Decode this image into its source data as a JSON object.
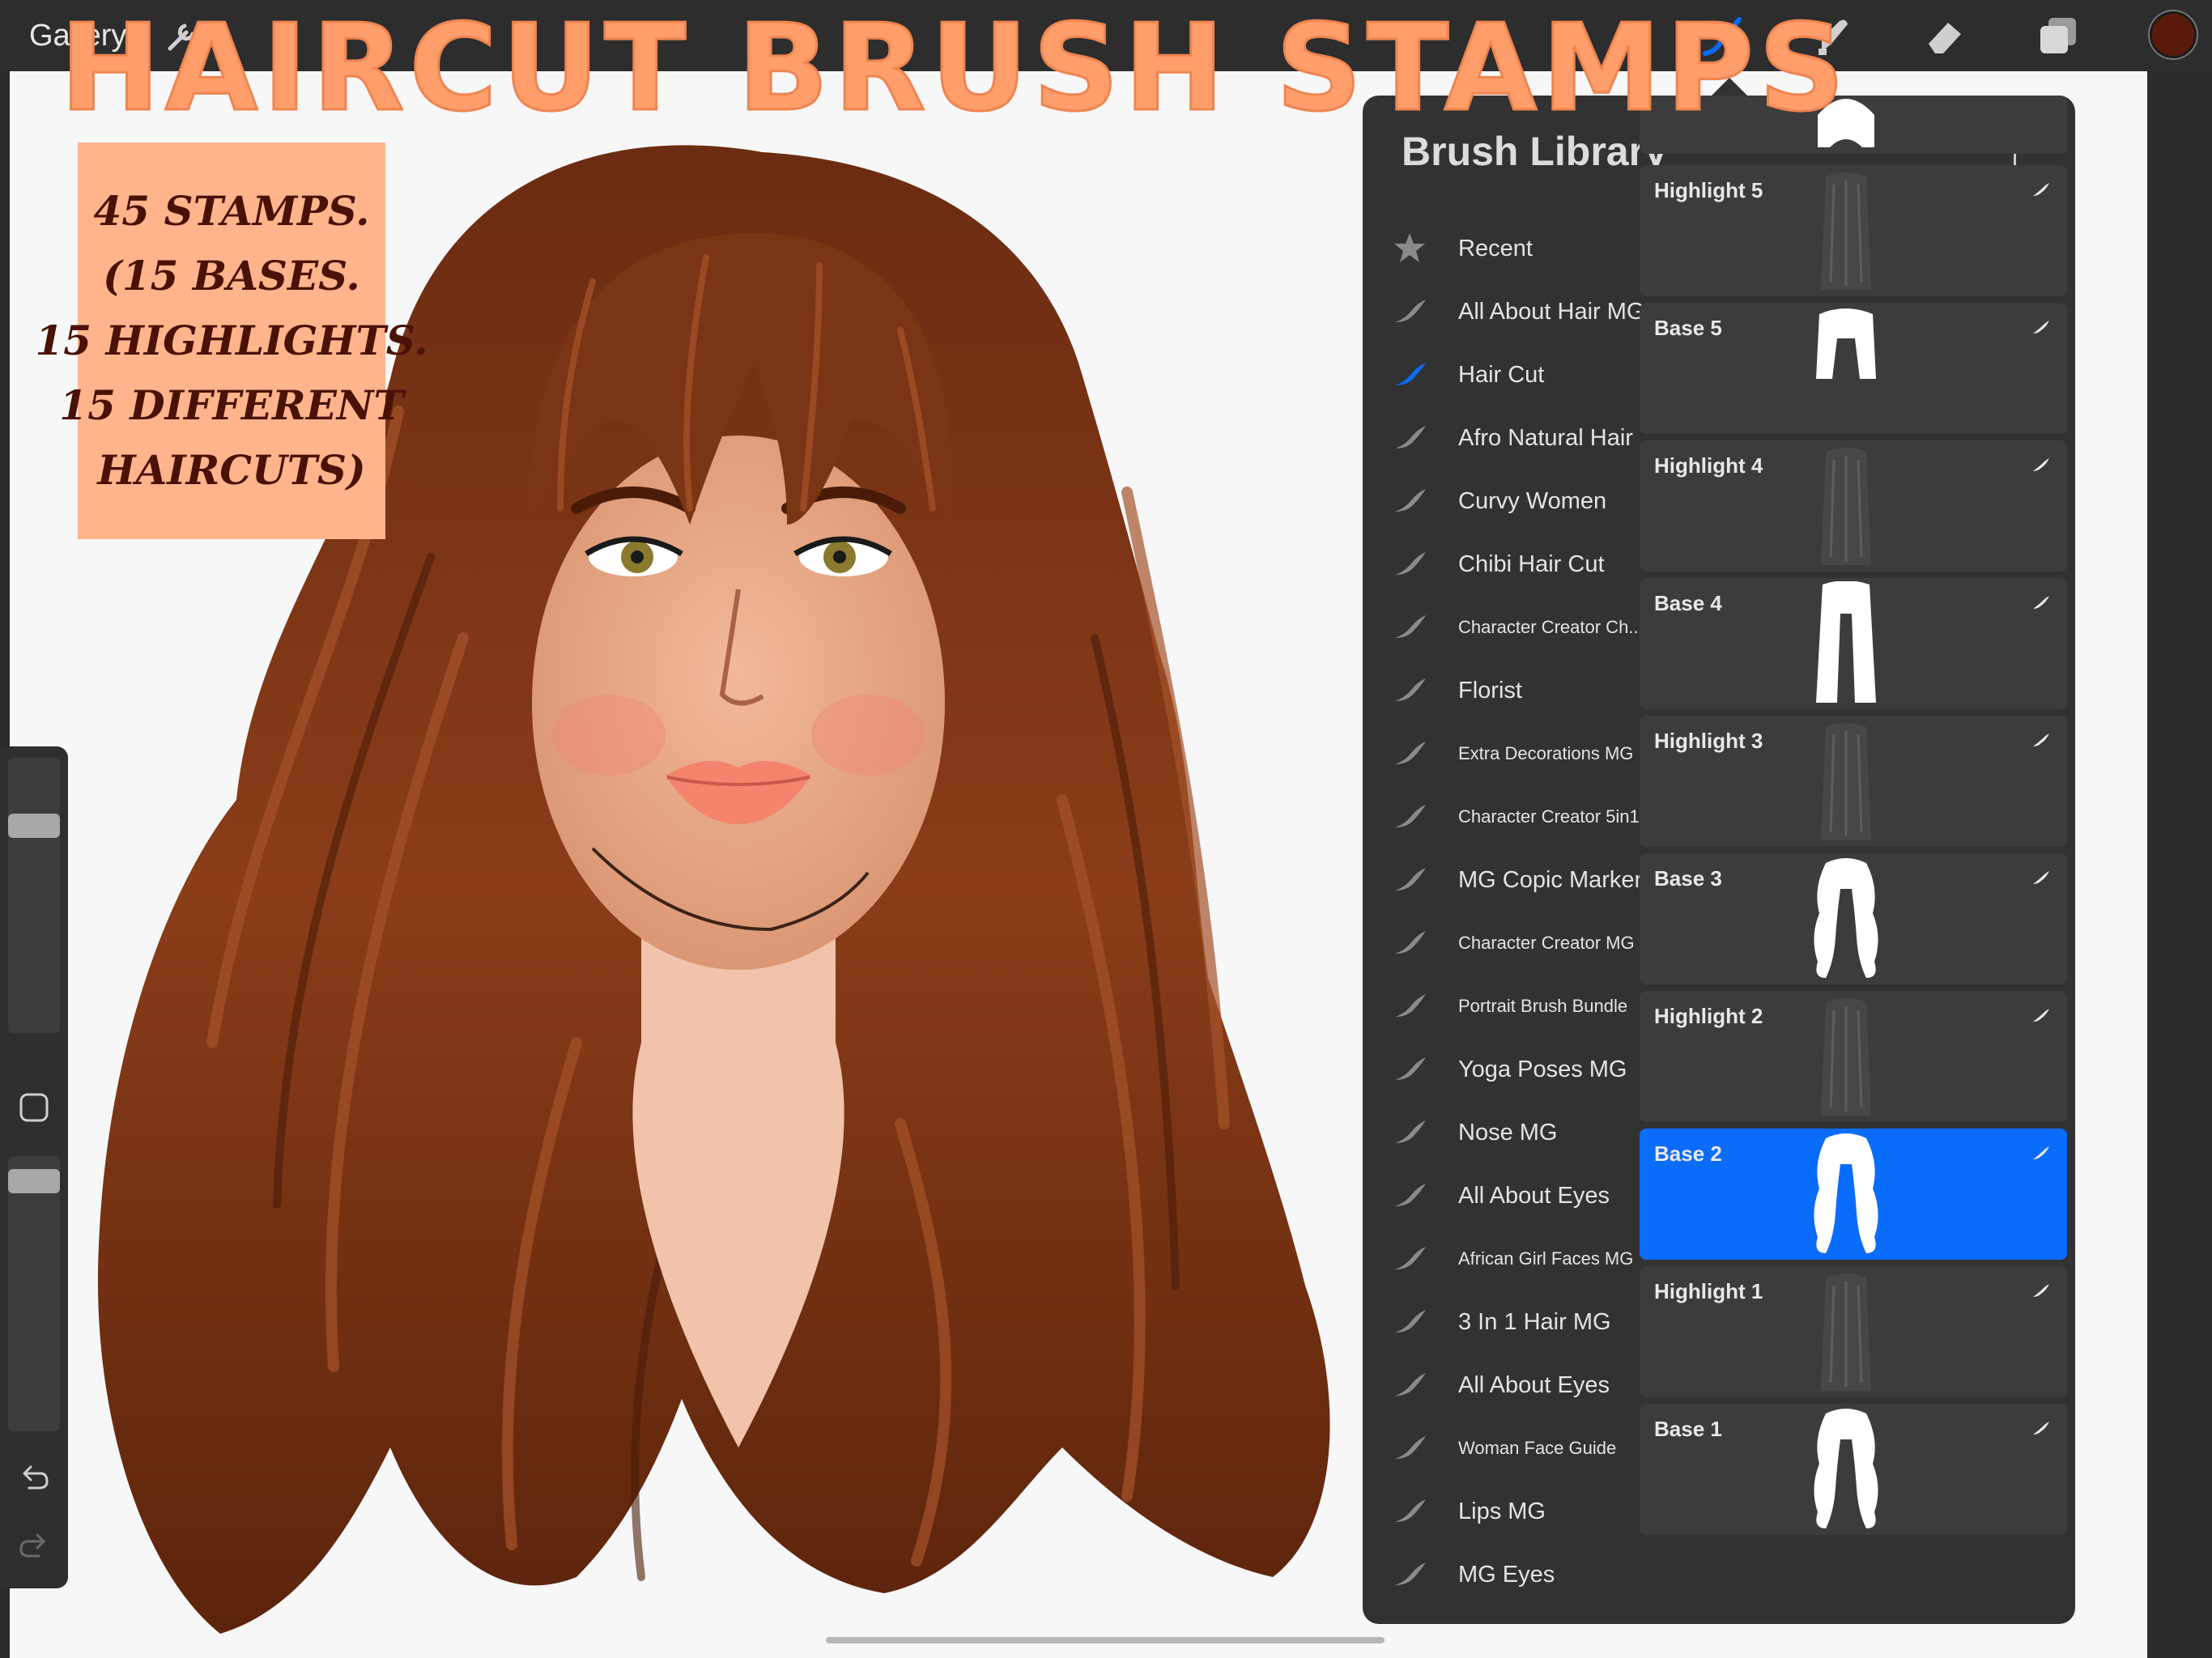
{
  "promo": {
    "title": "HAIRCUT BRUSH STAMPS",
    "info_lines": [
      "45 STAMPS.",
      "(15 BASES.",
      "15 HIGHLIGHTS.",
      "15 DIFFERENT",
      "HAIRCUTS)"
    ]
  },
  "topbar": {
    "gallery_label": "Gallery",
    "tools": [
      "brush-icon",
      "smudge-icon",
      "eraser-icon",
      "layers-icon"
    ],
    "color_well": "#5a1a0b",
    "active_tool_color": "#0a6cfb"
  },
  "sidebar": {
    "size_slider_level": 0.3,
    "opacity_slider_level": 0.05
  },
  "brush_library": {
    "title": "Brush Library",
    "brush_sets": [
      {
        "label": "Recent",
        "icon": "star-icon",
        "active": false,
        "small": false
      },
      {
        "label": "All About Hair MG",
        "icon": "brush-stroke-icon",
        "active": false,
        "small": false
      },
      {
        "label": "Hair Cut",
        "icon": "brush-stroke-icon",
        "active": true,
        "small": false
      },
      {
        "label": "Afro Natural Hair",
        "icon": "brush-stroke-icon",
        "active": false,
        "small": false
      },
      {
        "label": "Curvy Women",
        "icon": "brush-stroke-icon",
        "active": false,
        "small": false
      },
      {
        "label": "Chibi Hair Cut",
        "icon": "brush-stroke-icon",
        "active": false,
        "small": false
      },
      {
        "label": "Character Creator Ch...",
        "icon": "brush-stroke-icon",
        "active": false,
        "small": true
      },
      {
        "label": "Florist",
        "icon": "brush-stroke-icon",
        "active": false,
        "small": false
      },
      {
        "label": "Extra Decorations MG",
        "icon": "brush-stroke-icon",
        "active": false,
        "small": true
      },
      {
        "label": "Character Creator 5in1",
        "icon": "brush-stroke-icon",
        "active": false,
        "small": true
      },
      {
        "label": "MG Copic Markers",
        "icon": "brush-stroke-icon",
        "active": false,
        "small": false
      },
      {
        "label": "Character Creator MG",
        "icon": "brush-stroke-icon",
        "active": false,
        "small": true
      },
      {
        "label": "Portrait Brush Bundle",
        "icon": "brush-stroke-icon",
        "active": false,
        "small": true
      },
      {
        "label": "Yoga Poses MG",
        "icon": "brush-stroke-icon",
        "active": false,
        "small": false
      },
      {
        "label": "Nose MG",
        "icon": "brush-stroke-icon",
        "active": false,
        "small": false
      },
      {
        "label": "All About Eyes",
        "icon": "brush-stroke-icon",
        "active": false,
        "small": false
      },
      {
        "label": "African Girl Faces MG",
        "icon": "brush-stroke-icon",
        "active": false,
        "small": true
      },
      {
        "label": "3 In 1 Hair MG",
        "icon": "brush-stroke-icon",
        "active": false,
        "small": false
      },
      {
        "label": "All About Eyes",
        "icon": "brush-stroke-icon",
        "active": false,
        "small": false
      },
      {
        "label": "Woman Face Guide",
        "icon": "brush-stroke-icon",
        "active": false,
        "small": true
      },
      {
        "label": "Lips MG",
        "icon": "brush-stroke-icon",
        "active": false,
        "small": false
      },
      {
        "label": "MG Eyes",
        "icon": "brush-stroke-icon",
        "active": false,
        "small": false
      }
    ],
    "brushes": [
      {
        "name": "Highlight 5",
        "kind": "highlight",
        "selected": false
      },
      {
        "name": "Base 5",
        "kind": "base-short",
        "selected": false
      },
      {
        "name": "Highlight 4",
        "kind": "highlight",
        "selected": false
      },
      {
        "name": "Base 4",
        "kind": "base-straight",
        "selected": false
      },
      {
        "name": "Highlight 3",
        "kind": "highlight",
        "selected": false
      },
      {
        "name": "Base 3",
        "kind": "base-wavy",
        "selected": false
      },
      {
        "name": "Highlight 2",
        "kind": "highlight",
        "selected": false
      },
      {
        "name": "Base 2",
        "kind": "base-wavy",
        "selected": true
      },
      {
        "name": "Highlight 1",
        "kind": "highlight",
        "selected": false
      },
      {
        "name": "Base 1",
        "kind": "base-wavy",
        "selected": false
      }
    ]
  }
}
